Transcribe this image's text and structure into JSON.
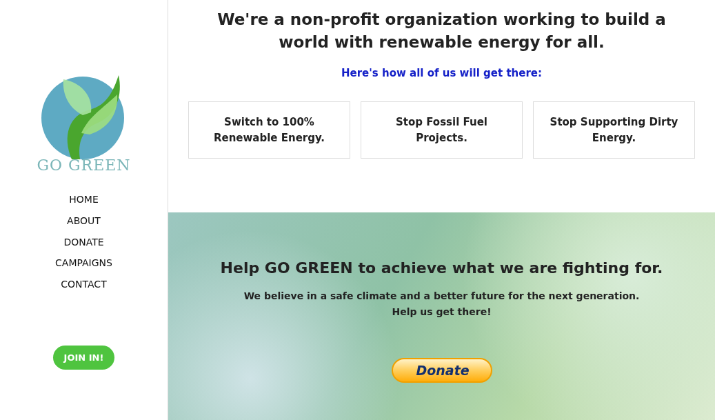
{
  "sidebar": {
    "logo_text": "GO GREEN",
    "nav": [
      "HOME",
      "ABOUT",
      "DONATE",
      "CAMPAIGNS",
      "CONTACT"
    ],
    "join_button": "JOIN IN!"
  },
  "intro": {
    "heading": "We're a non-profit organization working to build a world with renewable energy for all.",
    "subheading": "Here's how all of us will get there:",
    "cards": [
      "Switch to 100% Renewable Energy.",
      "Stop Fossil Fuel Projects.",
      "Stop Supporting Dirty Energy."
    ]
  },
  "hero": {
    "heading": "Help GO GREEN to achieve what we are fighting for.",
    "text_lines": [
      "We believe in a safe climate and a better future for the next generation.",
      "Help us get there!"
    ],
    "donate_button": "Donate"
  }
}
